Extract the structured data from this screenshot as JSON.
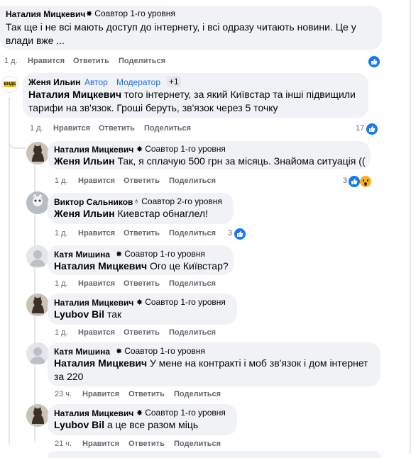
{
  "icons": {
    "like": "thumbs-up-icon",
    "wow": "wow-reaction-icon",
    "star": "star-badge-icon",
    "medal": "medal-badge-icon",
    "avatar": "user-avatar-icon"
  },
  "colors": {
    "like_blue": "#1877f2",
    "bubble_bg": "#f0f2f5",
    "muted": "#65676b",
    "role_blue": "#216fdb",
    "wow_yellow": "#f7b125"
  },
  "actions": {
    "like": "Нравится",
    "reply": "Ответить",
    "share": "Поделиться"
  },
  "comments": [
    {
      "author": "Наталия Мицкевич",
      "badge": "Соавтор 1-го уровня",
      "text": "Так ще і не всі мають доступ до інтернету, і всі одразу читають новини. Це у влади вже ...",
      "time": "1 д.",
      "reactions": ""
    },
    {
      "author": "Женя Ильин",
      "roles": [
        "Автор",
        "Модератор"
      ],
      "extra": "+1",
      "mention": "Наталия Мицкевич",
      "text": "того інтернету, за який Київстар та інші підвищили тарифи на зв'язок. Гроші беруть, зв'язок через 5 точку",
      "time": "1 д.",
      "reactions": "17",
      "avatar_text": "ВИДЕ"
    }
  ],
  "replies": [
    {
      "author": "Наталия Мицкевич",
      "badge": "Соавтор 1-го уровня",
      "mention": "Женя Ильин",
      "text": "Так, я сплачую 500 грн за місяць. Знайома ситуація ((",
      "time": "1 д.",
      "reactions": "3"
    },
    {
      "author": "Виктор Сальников",
      "badge": "Соавтор 2-го уровня",
      "mention": "Женя Ильин",
      "text": "Киевстар обнаглел!",
      "time": "1 д.",
      "reactions": "3"
    },
    {
      "author": "Катя Мишина",
      "badge": "Соавтор 1-го уровня",
      "mention": "Наталия Мицкевич",
      "text": "Ого це Київстар?",
      "time": "1 д.",
      "reactions": ""
    },
    {
      "author": "Наталия Мицкевич",
      "badge": "Соавтор 1-го уровня",
      "mention": "Lyubov Bil",
      "text": "так",
      "time": "1 д.",
      "reactions": ""
    },
    {
      "author": "Катя Мишина",
      "badge": "Соавтор 1-го уровня",
      "mention": "Наталия Мицкевич",
      "text": "У мене на контракті і моб зв'язок і дом інтернет за 220",
      "time": "23 ч.",
      "reactions": ""
    },
    {
      "author": "Наталия Мицкевич",
      "badge": "Соавтор 1-го уровня",
      "mention": "Lyubov Bil",
      "text": "а це все разом міць",
      "time": "21 ч.",
      "reactions": ""
    }
  ]
}
